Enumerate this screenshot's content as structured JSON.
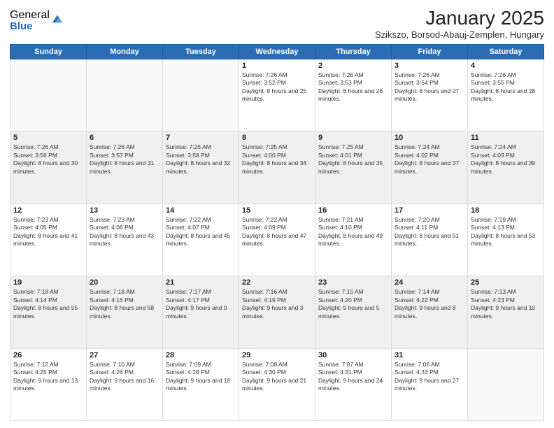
{
  "logo": {
    "general": "General",
    "blue": "Blue"
  },
  "title": "January 2025",
  "location": "Szikszo, Borsod-Abauj-Zemplen, Hungary",
  "days_of_week": [
    "Sunday",
    "Monday",
    "Tuesday",
    "Wednesday",
    "Thursday",
    "Friday",
    "Saturday"
  ],
  "weeks": [
    [
      {
        "day": "",
        "info": ""
      },
      {
        "day": "",
        "info": ""
      },
      {
        "day": "",
        "info": ""
      },
      {
        "day": "1",
        "info": "Sunrise: 7:26 AM\nSunset: 3:52 PM\nDaylight: 8 hours and 25 minutes."
      },
      {
        "day": "2",
        "info": "Sunrise: 7:26 AM\nSunset: 3:53 PM\nDaylight: 8 hours and 26 minutes."
      },
      {
        "day": "3",
        "info": "Sunrise: 7:26 AM\nSunset: 3:54 PM\nDaylight: 8 hours and 27 minutes."
      },
      {
        "day": "4",
        "info": "Sunrise: 7:26 AM\nSunset: 3:55 PM\nDaylight: 8 hours and 28 minutes."
      }
    ],
    [
      {
        "day": "5",
        "info": "Sunrise: 7:26 AM\nSunset: 3:56 PM\nDaylight: 8 hours and 30 minutes."
      },
      {
        "day": "6",
        "info": "Sunrise: 7:26 AM\nSunset: 3:57 PM\nDaylight: 8 hours and 31 minutes."
      },
      {
        "day": "7",
        "info": "Sunrise: 7:25 AM\nSunset: 3:58 PM\nDaylight: 8 hours and 32 minutes."
      },
      {
        "day": "8",
        "info": "Sunrise: 7:25 AM\nSunset: 4:00 PM\nDaylight: 8 hours and 34 minutes."
      },
      {
        "day": "9",
        "info": "Sunrise: 7:25 AM\nSunset: 4:01 PM\nDaylight: 8 hours and 35 minutes."
      },
      {
        "day": "10",
        "info": "Sunrise: 7:24 AM\nSunset: 4:02 PM\nDaylight: 8 hours and 37 minutes."
      },
      {
        "day": "11",
        "info": "Sunrise: 7:24 AM\nSunset: 4:03 PM\nDaylight: 8 hours and 39 minutes."
      }
    ],
    [
      {
        "day": "12",
        "info": "Sunrise: 7:23 AM\nSunset: 4:05 PM\nDaylight: 8 hours and 41 minutes."
      },
      {
        "day": "13",
        "info": "Sunrise: 7:23 AM\nSunset: 4:06 PM\nDaylight: 8 hours and 43 minutes."
      },
      {
        "day": "14",
        "info": "Sunrise: 7:22 AM\nSunset: 4:07 PM\nDaylight: 8 hours and 45 minutes."
      },
      {
        "day": "15",
        "info": "Sunrise: 7:22 AM\nSunset: 4:09 PM\nDaylight: 8 hours and 47 minutes."
      },
      {
        "day": "16",
        "info": "Sunrise: 7:21 AM\nSunset: 4:10 PM\nDaylight: 8 hours and 49 minutes."
      },
      {
        "day": "17",
        "info": "Sunrise: 7:20 AM\nSunset: 4:11 PM\nDaylight: 8 hours and 51 minutes."
      },
      {
        "day": "18",
        "info": "Sunrise: 7:19 AM\nSunset: 4:13 PM\nDaylight: 8 hours and 53 minutes."
      }
    ],
    [
      {
        "day": "19",
        "info": "Sunrise: 7:18 AM\nSunset: 4:14 PM\nDaylight: 8 hours and 55 minutes."
      },
      {
        "day": "20",
        "info": "Sunrise: 7:18 AM\nSunset: 4:16 PM\nDaylight: 8 hours and 58 minutes."
      },
      {
        "day": "21",
        "info": "Sunrise: 7:17 AM\nSunset: 4:17 PM\nDaylight: 9 hours and 0 minutes."
      },
      {
        "day": "22",
        "info": "Sunrise: 7:16 AM\nSunset: 4:19 PM\nDaylight: 9 hours and 3 minutes."
      },
      {
        "day": "23",
        "info": "Sunrise: 7:15 AM\nSunset: 4:20 PM\nDaylight: 9 hours and 5 minutes."
      },
      {
        "day": "24",
        "info": "Sunrise: 7:14 AM\nSunset: 4:22 PM\nDaylight: 9 hours and 8 minutes."
      },
      {
        "day": "25",
        "info": "Sunrise: 7:13 AM\nSunset: 4:23 PM\nDaylight: 9 hours and 10 minutes."
      }
    ],
    [
      {
        "day": "26",
        "info": "Sunrise: 7:12 AM\nSunset: 4:25 PM\nDaylight: 9 hours and 13 minutes."
      },
      {
        "day": "27",
        "info": "Sunrise: 7:10 AM\nSunset: 4:26 PM\nDaylight: 9 hours and 16 minutes."
      },
      {
        "day": "28",
        "info": "Sunrise: 7:09 AM\nSunset: 4:28 PM\nDaylight: 9 hours and 18 minutes."
      },
      {
        "day": "29",
        "info": "Sunrise: 7:08 AM\nSunset: 4:30 PM\nDaylight: 9 hours and 21 minutes."
      },
      {
        "day": "30",
        "info": "Sunrise: 7:07 AM\nSunset: 4:31 PM\nDaylight: 9 hours and 24 minutes."
      },
      {
        "day": "31",
        "info": "Sunrise: 7:06 AM\nSunset: 4:33 PM\nDaylight: 9 hours and 27 minutes."
      },
      {
        "day": "",
        "info": ""
      }
    ]
  ]
}
